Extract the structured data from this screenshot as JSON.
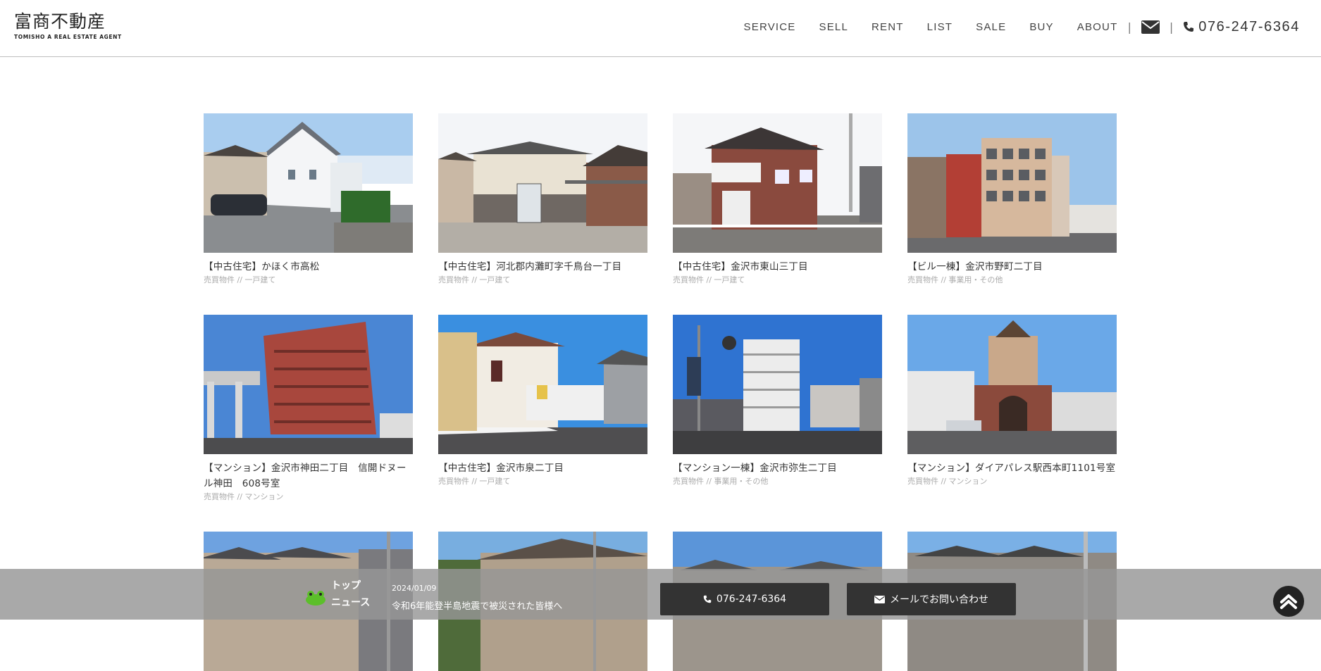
{
  "header": {
    "logo_main": "富商不動産",
    "logo_sub": "TOMISHO A REAL ESTATE AGENT",
    "nav": [
      "SERVICE",
      "SELL",
      "RENT",
      "LIST",
      "SALE",
      "BUY",
      "ABOUT"
    ],
    "separator": "|",
    "phone": "076-247-6364"
  },
  "listings": [
    {
      "title": "【中古住宅】かほく市高松",
      "category": "売買物件 // 一戸建て"
    },
    {
      "title": "【中古住宅】河北郡内灘町字千鳥台一丁目",
      "category": "売買物件 // 一戸建て"
    },
    {
      "title": "【中古住宅】金沢市東山三丁目",
      "category": "売買物件 // 一戸建て"
    },
    {
      "title": "【ビル一棟】金沢市野町二丁目",
      "category": "売買物件 // 事業用・その他"
    },
    {
      "title": "【マンション】金沢市神田二丁目　信開ドヌール神田　608号室",
      "category": "売買物件 // マンション"
    },
    {
      "title": "【中古住宅】金沢市泉二丁目",
      "category": "売買物件 // 一戸建て"
    },
    {
      "title": "【マンション一棟】金沢市弥生二丁目",
      "category": "売買物件 // 事業用・その他"
    },
    {
      "title": "【マンション】ダイアパレス駅西本町1101号室",
      "category": "売買物件 // マンション"
    }
  ],
  "footer_bar": {
    "news_label_1": "トップ",
    "news_label_2": "ニュース",
    "news_date": "2024/01/09",
    "news_text": "令和6年能登半島地震で被災された皆様へ",
    "tel_button": "076-247-6364",
    "mail_button": "メールでお問い合わせ"
  },
  "colors": {
    "header_border": "#bdbdbd",
    "bar": "#969696",
    "cta": "#333333"
  }
}
